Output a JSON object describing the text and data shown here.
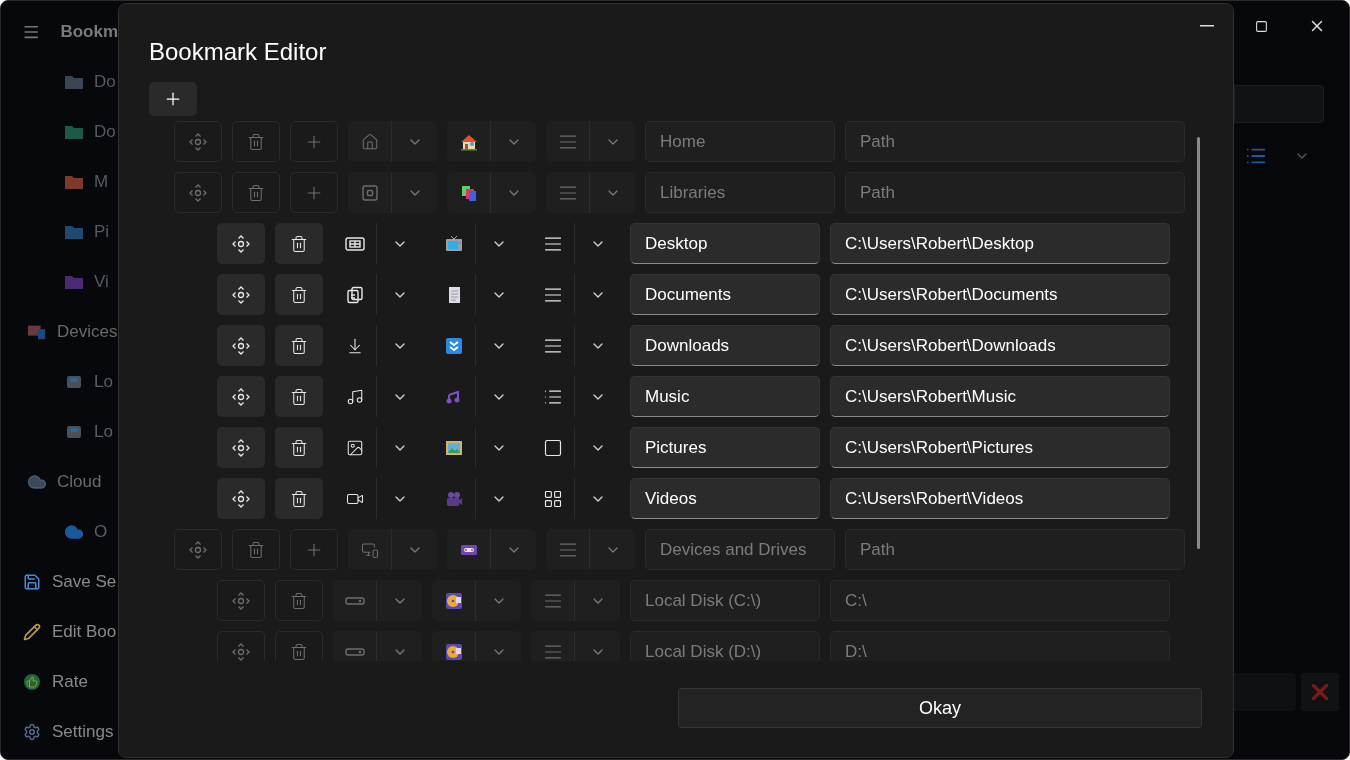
{
  "app": {
    "title": "Bookm",
    "bookmarks": [
      {
        "label": "Do",
        "kind": "documents"
      },
      {
        "label": "Do",
        "kind": "downloads"
      },
      {
        "label": "M",
        "kind": "music"
      },
      {
        "label": "Pi",
        "kind": "pictures"
      },
      {
        "label": "Vi",
        "kind": "videos"
      }
    ],
    "items": [
      {
        "label": "Devices",
        "kind": "devices",
        "children": [
          {
            "label": "Lo",
            "kind": "disk"
          },
          {
            "label": "Lo",
            "kind": "disk"
          }
        ]
      },
      {
        "label": "Cloud",
        "kind": "cloud",
        "children": [
          {
            "label": "O",
            "kind": "onedrive"
          }
        ]
      }
    ],
    "actions": [
      {
        "label": "Save Se",
        "kind": "save"
      },
      {
        "label": "Edit Boo",
        "kind": "edit"
      },
      {
        "label": "Rate",
        "kind": "rate"
      },
      {
        "label": "Settings",
        "kind": "settings"
      }
    ]
  },
  "dialog": {
    "title": "Bookmark Editor",
    "rows": [
      {
        "enabled": false,
        "name": "Home",
        "path_placeholder": "Path"
      },
      {
        "enabled": false,
        "name": "Libraries",
        "path_placeholder": "Path",
        "children": [
          {
            "enabled": true,
            "name": "Desktop",
            "path": "C:\\Users\\Robert\\Desktop"
          },
          {
            "enabled": true,
            "name": "Documents",
            "path": "C:\\Users\\Robert\\Documents"
          },
          {
            "enabled": true,
            "name": "Downloads",
            "path": "C:\\Users\\Robert\\Downloads"
          },
          {
            "enabled": true,
            "name": "Music",
            "path": "C:\\Users\\Robert\\Music"
          },
          {
            "enabled": true,
            "name": "Pictures",
            "path": "C:\\Users\\Robert\\Pictures"
          },
          {
            "enabled": true,
            "name": "Videos",
            "path": "C:\\Users\\Robert\\Videos"
          }
        ]
      },
      {
        "enabled": false,
        "name": "Devices and Drives",
        "path_placeholder": "Path",
        "children": [
          {
            "enabled": false,
            "name": "Local Disk (C:\\)",
            "path": "C:\\"
          },
          {
            "enabled": false,
            "name": "Local Disk (D:\\)",
            "path": "D:\\"
          }
        ]
      }
    ],
    "okay_button": "Okay"
  }
}
